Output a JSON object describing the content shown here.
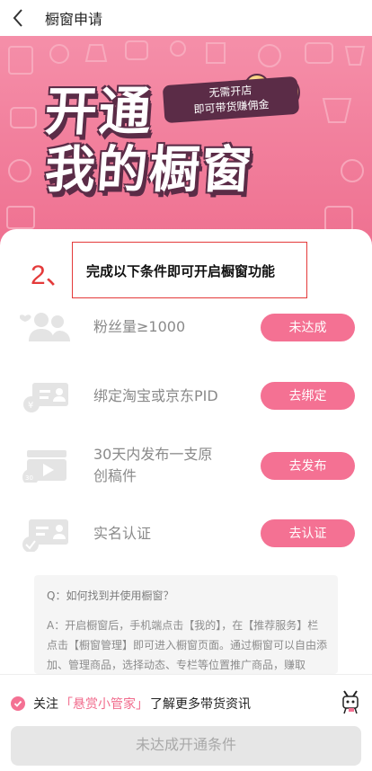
{
  "header": {
    "title": "橱窗申请",
    "back_icon": "back-chevron-icon"
  },
  "banner": {
    "badge_line1": "无需开店",
    "badge_line2": "即可带货赚佣金",
    "title_line1": "开通",
    "title_line2": "我的橱窗",
    "colors": {
      "pink": "#f2809d",
      "dark": "#5b2c47",
      "gold": "#f5c86a"
    }
  },
  "steps": {
    "number": "2、",
    "title": "完成以下条件即可开启橱窗功能"
  },
  "conditions": [
    {
      "icon": "fans-icon",
      "text": "粉丝量≥1000",
      "button": "未达成"
    },
    {
      "icon": "bind-account-icon",
      "text": "绑定淘宝或京东PID",
      "button": "去绑定"
    },
    {
      "icon": "video-icon",
      "text_line1": "30天内发布一支原",
      "text_line2": "创稿件",
      "button": "去发布"
    },
    {
      "icon": "id-card-icon",
      "text": "实名认证",
      "button": "去认证"
    }
  ],
  "faq": {
    "question": "Q：如何找到并使用橱窗？",
    "answer": "A：开启橱窗后，手机端点击【我的】，在【推荐服务】栏点击【橱窗管理】即可进入橱窗页面。通过橱窗可以自由添加、管理商品，选择动态、专栏等位置推广商品，赚取"
  },
  "footer": {
    "follow_prefix": "关注",
    "follow_link": "「悬赏小管家」",
    "follow_suffix": "了解更多带货资讯",
    "submit_label": "未达成开通条件"
  },
  "accent_color": "#f47193"
}
